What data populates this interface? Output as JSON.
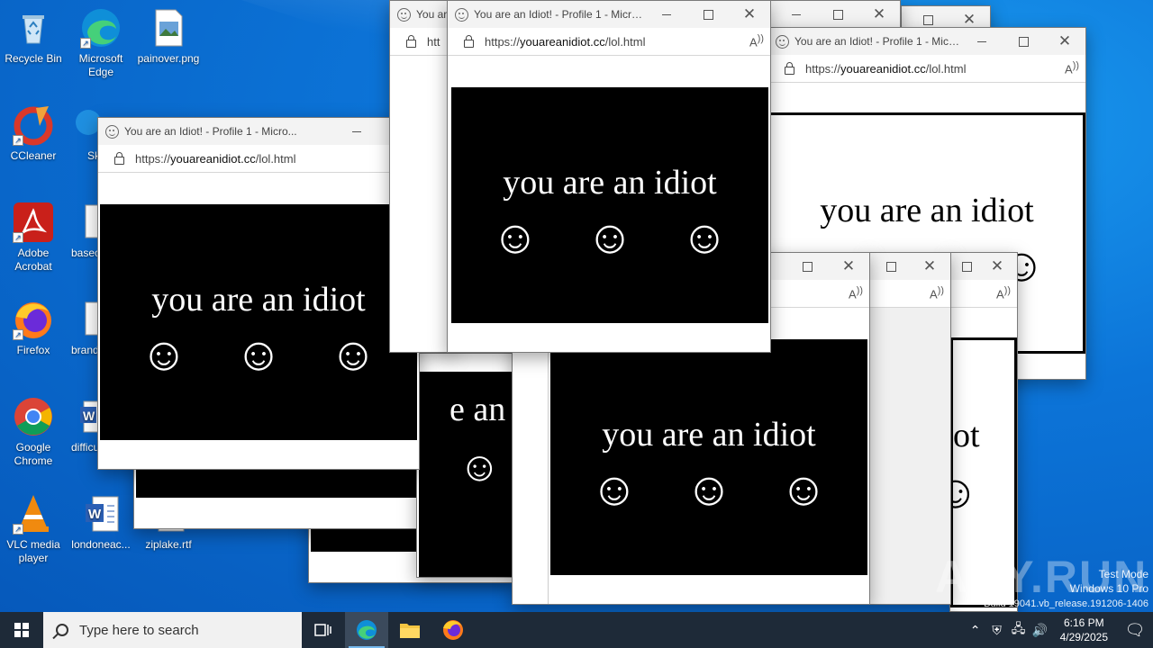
{
  "desktop": {
    "icons": [
      {
        "label": "Recycle Bin",
        "icon": "recycle-bin-icon"
      },
      {
        "label": "Microsoft Edge",
        "icon": "edge-icon"
      },
      {
        "label": "painover.png",
        "icon": "image-file-icon"
      },
      {
        "label": "CCleaner",
        "icon": "ccleaner-icon"
      },
      {
        "label": "Sk",
        "icon": "app-icon"
      },
      {
        "label": "Adobe Acrobat",
        "icon": "acrobat-icon"
      },
      {
        "label": "basec",
        "icon": "file-icon"
      },
      {
        "label": "Firefox",
        "icon": "firefox-icon"
      },
      {
        "label": "brand",
        "icon": "file-icon"
      },
      {
        "label": "Google Chrome",
        "icon": "chrome-icon"
      },
      {
        "label": "difficu",
        "icon": "word-icon"
      },
      {
        "label": "VLC media player",
        "icon": "vlc-icon"
      },
      {
        "label": "londoneac...",
        "icon": "word-icon"
      },
      {
        "label": "ziplake.rtf",
        "icon": "rtf-icon"
      }
    ]
  },
  "popup": {
    "title": "You are an Idiot! - Profile 1 - Micro...",
    "title_short": "You are",
    "url_prefix": "https://",
    "url_domain": "youareanidiot.cc",
    "url_path": "/lol.html",
    "url_stub": "htt",
    "message": "you are an idiot",
    "message_fragment_a": "e an",
    "message_fragment_b": "ot",
    "faces": [
      "☺",
      "☺",
      "☺"
    ]
  },
  "watermark": {
    "brand": "ANY.RUN",
    "line1": "Test Mode",
    "line2": "Windows 10 Pro",
    "line3": "Build 19041.vb_release.191206-1406"
  },
  "taskbar": {
    "search_placeholder": "Type here to search",
    "time": "6:16 PM",
    "date": "4/29/2025"
  }
}
